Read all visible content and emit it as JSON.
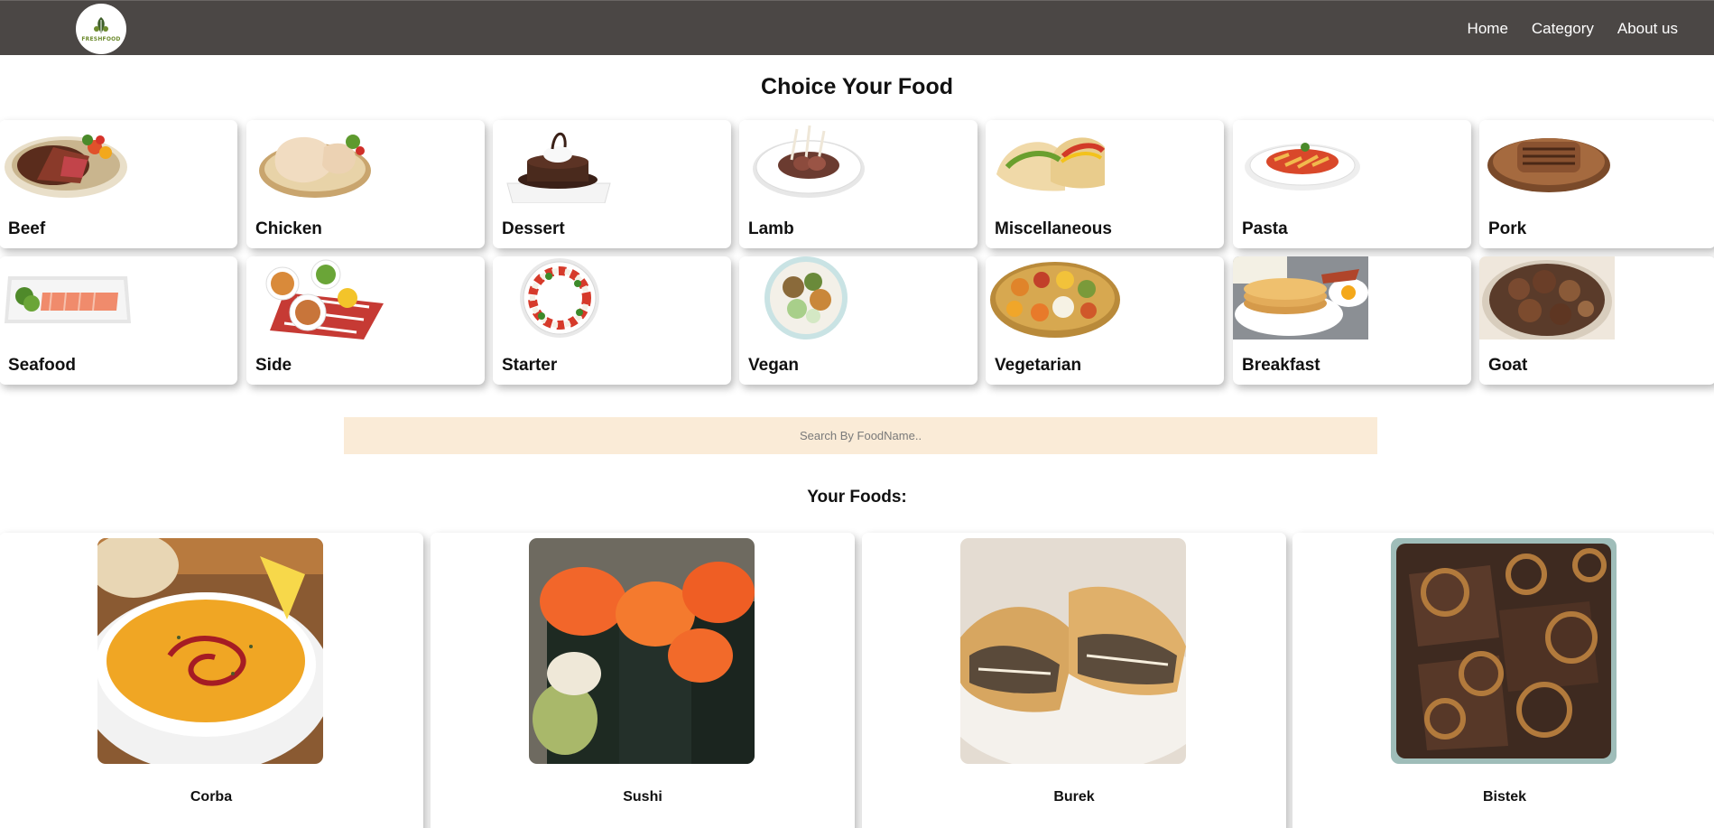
{
  "brand": {
    "logo_text": "FRESHFOOD"
  },
  "nav": {
    "items": [
      {
        "label": "Home"
      },
      {
        "label": "Category"
      },
      {
        "label": "About us"
      }
    ]
  },
  "page": {
    "title": "Choice Your Food"
  },
  "categories": [
    {
      "label": "Beef"
    },
    {
      "label": "Chicken"
    },
    {
      "label": "Dessert"
    },
    {
      "label": "Lamb"
    },
    {
      "label": "Miscellaneous"
    },
    {
      "label": "Pasta"
    },
    {
      "label": "Pork"
    },
    {
      "label": "Seafood"
    },
    {
      "label": "Side"
    },
    {
      "label": "Starter"
    },
    {
      "label": "Vegan"
    },
    {
      "label": "Vegetarian"
    },
    {
      "label": "Breakfast"
    },
    {
      "label": "Goat"
    }
  ],
  "search": {
    "placeholder": "Search By FoodName..",
    "value": ""
  },
  "foods_section": {
    "title": "Your Foods:"
  },
  "foods": [
    {
      "name": "Corba"
    },
    {
      "name": "Sushi"
    },
    {
      "name": "Burek"
    },
    {
      "name": "Bistek"
    }
  ],
  "colors": {
    "navbar": "#4b4745",
    "search_bg": "#faebd7",
    "logo_green": "#6d8b2e"
  }
}
